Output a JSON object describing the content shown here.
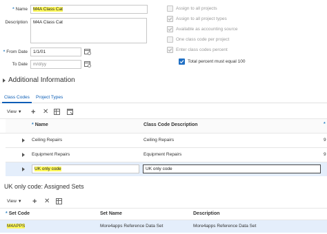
{
  "form": {
    "name_label": "Name",
    "name_value": "M4A Class Cat",
    "description_label": "Description",
    "description_value": "M4A Class Cat",
    "from_date_label": "From Date",
    "from_date_value": "1/1/01",
    "to_date_label": "To Date",
    "to_date_placeholder": "m/d/yy"
  },
  "options": [
    {
      "label": "Assign to all projects",
      "checked": false,
      "enabled": false
    },
    {
      "label": "Assign to all project types",
      "checked": true,
      "enabled": false
    },
    {
      "label": "Available as accounting source",
      "checked": true,
      "enabled": false
    },
    {
      "label": "One class code per project",
      "checked": false,
      "enabled": false
    },
    {
      "label": "Enter class codes percent",
      "checked": true,
      "enabled": false
    },
    {
      "label": "Total percent must equal 100",
      "checked": true,
      "enabled": true
    }
  ],
  "additional_info_label": "Additional Information",
  "tabs": [
    {
      "label": "Class Codes",
      "selected": true
    },
    {
      "label": "Project Types",
      "selected": false
    }
  ],
  "class_codes": {
    "view_label": "View",
    "columns": [
      "Name",
      "Class Code Description"
    ],
    "rows": [
      {
        "name": "Ceiling Repairs",
        "description": "Ceiling Repairs",
        "extra": "9"
      },
      {
        "name": "Equipment Repairs",
        "description": "Equipment Repairs",
        "extra": "9"
      },
      {
        "name": "UK only code",
        "description": "UK only code",
        "extra": ""
      }
    ]
  },
  "assigned_sets": {
    "title": "UK only code: Assigned Sets",
    "view_label": "View",
    "columns": [
      "Set Code",
      "Set Name",
      "Description"
    ],
    "rows": [
      {
        "code": "M4APPS",
        "name": "More4apps Reference Data Set",
        "description": "More4apps Reference Data Set"
      }
    ]
  },
  "colors": {
    "accent": "#0b5db6",
    "highlight": "#fff95a",
    "selected_row": "#e4eefb"
  },
  "icons": [
    "calendar-icon",
    "add-icon",
    "delete-icon",
    "freeze-icon",
    "detach-icon",
    "expand-icon",
    "dropdown-icon"
  ]
}
